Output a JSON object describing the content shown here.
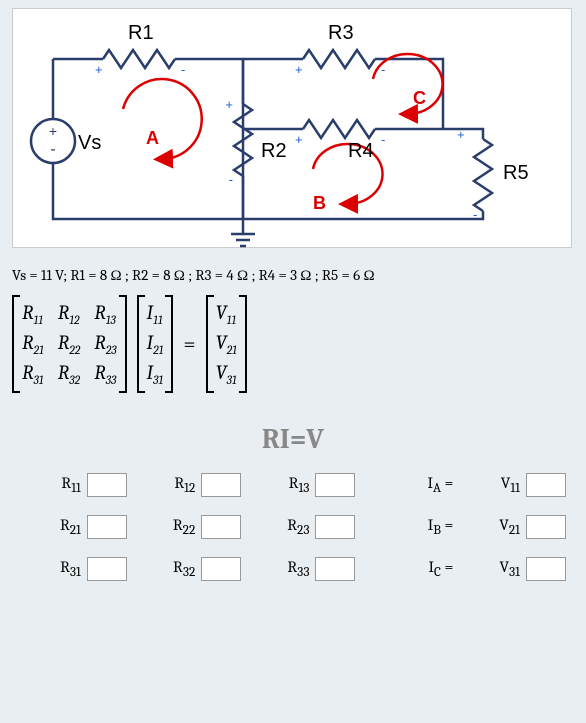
{
  "circuit": {
    "components": {
      "Vs": "Vs",
      "R1": "R1",
      "R2": "R2",
      "R3": "R3",
      "R4": "R4",
      "R5": "R5"
    },
    "loops": {
      "A": "A",
      "B": "B",
      "C": "C"
    },
    "polarity": {
      "plus": "+",
      "minus": "-"
    }
  },
  "params_line": "Vs = 11 V; R1 = 8 Ω ; R2 = 8 Ω ; R3 = 4 Ω ; R4 = 3 Ω ; R5 = 6 Ω",
  "matrix": {
    "R": [
      [
        "R",
        "11"
      ],
      [
        "R",
        "12"
      ],
      [
        "R",
        "13"
      ],
      [
        "R",
        "21"
      ],
      [
        "R",
        "22"
      ],
      [
        "R",
        "23"
      ],
      [
        "R",
        "31"
      ],
      [
        "R",
        "32"
      ],
      [
        "R",
        "33"
      ]
    ],
    "I": [
      [
        "I",
        "11"
      ],
      [
        "I",
        "21"
      ],
      [
        "I",
        "31"
      ]
    ],
    "V": [
      [
        "V",
        "11"
      ],
      [
        "V",
        "21"
      ],
      [
        "V",
        "31"
      ]
    ],
    "eq": "="
  },
  "section_title": "RI=V",
  "answer_grid": {
    "rows": [
      {
        "r": [
          "R₁₁",
          "R₁₂",
          "R₁₃"
        ],
        "i": "Iₐ",
        "v": "V₁₁"
      },
      {
        "r": [
          "R₂₁",
          "R₂₂",
          "R₂₃"
        ],
        "i": "I_B",
        "v": "V₂₁"
      },
      {
        "r": [
          "R₃₁",
          "R₃₂",
          "R₃₃"
        ],
        "i": "I_C",
        "v": "V₃₁"
      }
    ],
    "labels": {
      "R11": "R",
      "R12": "R",
      "R13": "R",
      "R21": "R",
      "R22": "R",
      "R23": "R",
      "R31": "R",
      "R32": "R",
      "R33": "R",
      "s11": "11",
      "s12": "12",
      "s13": "13",
      "s21": "21",
      "s22": "22",
      "s23": "23",
      "s31": "31",
      "s32": "32",
      "s33": "33",
      "IA": "I",
      "IB": "I",
      "IC": "I",
      "sA": "A",
      "sB": "B",
      "sC": "C",
      "eq": "=",
      "V11": "V",
      "V21": "V",
      "V31": "V",
      "sv11": "11",
      "sv21": "21",
      "sv31": "31"
    }
  },
  "chart_data": {
    "type": "table",
    "title": "Mesh analysis RI=V",
    "parameters": {
      "Vs": 11,
      "R1": 8,
      "R2": 8,
      "R3": 4,
      "R4": 3,
      "R5": 6,
      "units": {
        "Vs": "V",
        "R": "Ω"
      }
    },
    "unknowns_matrix_R": [
      [
        "R11",
        "R12",
        "R13"
      ],
      [
        "R21",
        "R22",
        "R23"
      ],
      [
        "R31",
        "R32",
        "R33"
      ]
    ],
    "unknowns_vector_I": [
      "I11(IA)",
      "I21(IB)",
      "I31(IC)"
    ],
    "unknowns_vector_V": [
      "V11",
      "V21",
      "V31"
    ]
  }
}
